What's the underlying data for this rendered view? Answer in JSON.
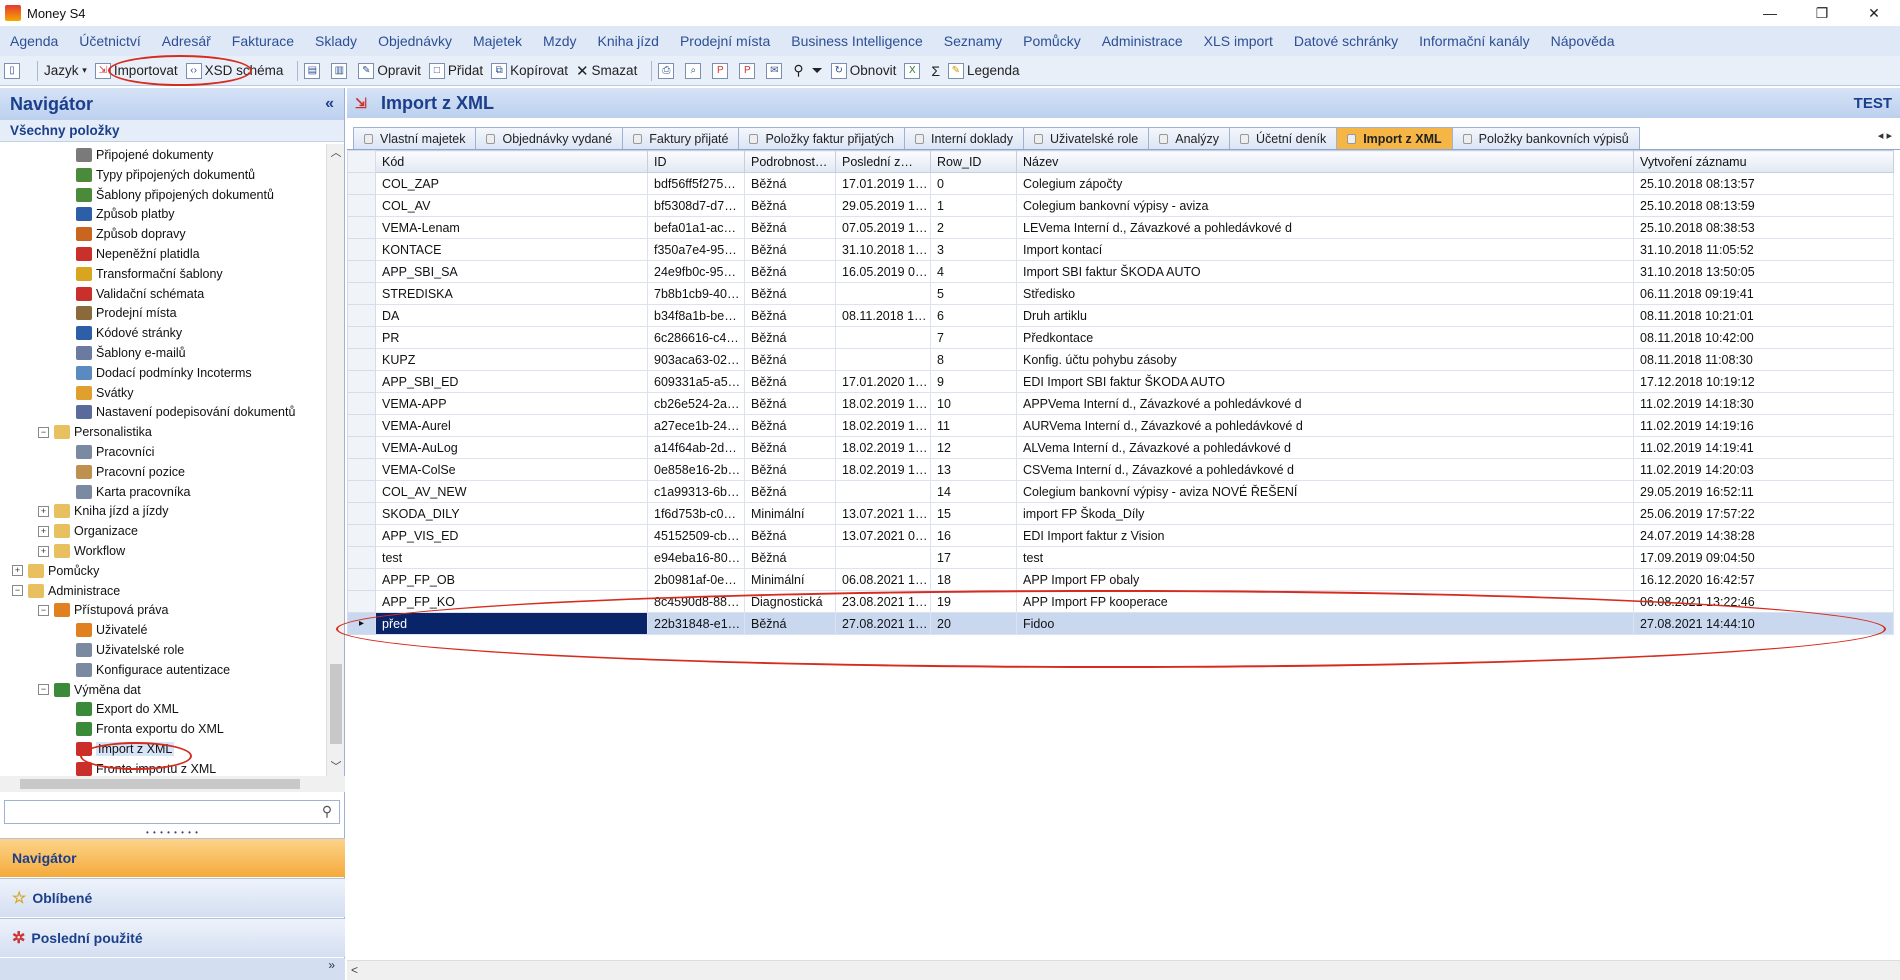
{
  "window": {
    "title": "Money S4",
    "controls": [
      "—",
      "❐",
      "✕"
    ]
  },
  "menu": [
    "Agenda",
    "Účetnictví",
    "Adresář",
    "Fakturace",
    "Sklady",
    "Objednávky",
    "Majetek",
    "Mzdy",
    "Kniha jízd",
    "Prodejní místa",
    "Business Intelligence",
    "Seznamy",
    "Pomůcky",
    "Administrace",
    "XLS import",
    "Datové schránky",
    "Informační kanály",
    "Nápověda"
  ],
  "toolbar": {
    "language": "Jazyk",
    "import": "Importovat",
    "xsd": "XSD schéma",
    "edit": "Opravit",
    "add": "Přidat",
    "copy": "Kopírovat",
    "delete": "Smazat",
    "refresh": "Obnovit",
    "legend": "Legenda"
  },
  "navigator": {
    "title": "Navigátor",
    "collapse": "«",
    "subtitle": "Všechny položky",
    "tree": [
      {
        "label": "Připojené dokumenty",
        "level": 3,
        "color": "#7a7a7a"
      },
      {
        "label": "Typy připojených dokumentů",
        "level": 3,
        "color": "#4a8a3a"
      },
      {
        "label": "Šablony připojených dokumentů",
        "level": 3,
        "color": "#4a8a3a"
      },
      {
        "label": "Způsob platby",
        "level": 3,
        "color": "#2d5fa8"
      },
      {
        "label": "Způsob dopravy",
        "level": 3,
        "color": "#c9651e"
      },
      {
        "label": "Nepeněžní platidla",
        "level": 3,
        "color": "#c9302c"
      },
      {
        "label": "Transformační šablony",
        "level": 3,
        "color": "#d9a521"
      },
      {
        "label": "Validační schémata",
        "level": 3,
        "color": "#c9302c"
      },
      {
        "label": "Prodejní místa",
        "level": 3,
        "color": "#8a6a3a"
      },
      {
        "label": "Kódové stránky",
        "level": 3,
        "color": "#2d5fa8"
      },
      {
        "label": "Šablony e-mailů",
        "level": 3,
        "color": "#6a7aa0"
      },
      {
        "label": "Dodací podmínky Incoterms",
        "level": 3,
        "color": "#5a8ac0"
      },
      {
        "label": "Svátky",
        "level": 3,
        "color": "#e0a030"
      },
      {
        "label": "Nastavení podepisování dokumentů",
        "level": 3,
        "color": "#5a6a9a"
      },
      {
        "label": "Personalistika",
        "level": 2,
        "exp": "−",
        "color": "#e8c060"
      },
      {
        "label": "Pracovníci",
        "level": 3,
        "color": "#7a8aa0"
      },
      {
        "label": "Pracovní pozice",
        "level": 3,
        "color": "#c09050"
      },
      {
        "label": "Karta pracovníka",
        "level": 3,
        "color": "#7a8aa0"
      },
      {
        "label": "Kniha jízd a jízdy",
        "level": 2,
        "exp": "+",
        "color": "#e8c060"
      },
      {
        "label": "Organizace",
        "level": 2,
        "exp": "+",
        "color": "#e8c060"
      },
      {
        "label": "Workflow",
        "level": 2,
        "exp": "+",
        "color": "#e8c060"
      },
      {
        "label": "Pomůcky",
        "level": 1,
        "exp": "+",
        "color": "#e8c060"
      },
      {
        "label": "Administrace",
        "level": 1,
        "exp": "−",
        "color": "#e8c060"
      },
      {
        "label": "Přístupová práva",
        "level": 2,
        "exp": "−",
        "color": "#e08020"
      },
      {
        "label": "Uživatelé",
        "level": 3,
        "color": "#e08020"
      },
      {
        "label": "Uživatelské role",
        "level": 3,
        "color": "#7a8aa0"
      },
      {
        "label": "Konfigurace autentizace",
        "level": 3,
        "color": "#7a8aa0"
      },
      {
        "label": "Výměna dat",
        "level": 2,
        "exp": "−",
        "color": "#3a8a3a"
      },
      {
        "label": "Export do XML",
        "level": 3,
        "color": "#3a8a3a"
      },
      {
        "label": "Fronta exportu do XML",
        "level": 3,
        "color": "#3a8a3a"
      },
      {
        "label": "Import z XML",
        "level": 3,
        "color": "#c9302c",
        "selected": true
      },
      {
        "label": "Fronta importu z XML",
        "level": 3,
        "color": "#c9302c"
      }
    ],
    "panels": [
      {
        "label": "Navigátor",
        "icon": "",
        "active": true
      },
      {
        "label": "Oblíbené",
        "icon": "☆"
      },
      {
        "label": "Poslední použité",
        "icon": "✲"
      }
    ],
    "footer": "»"
  },
  "main": {
    "title": "Import z XML",
    "badge": "TEST",
    "tabs": [
      "Vlastní majetek",
      "Objednávky vydané",
      "Faktury přijaté",
      "Položky faktur přijatých",
      "Interní doklady",
      "Uživatelské role",
      "Analýzy",
      "Účetní deník",
      "Import z XML",
      "Položky bankovních výpisů"
    ],
    "active_tab": "Import z XML",
    "tab_arrows": "◂ ▸",
    "columns": [
      "Kód",
      "ID",
      "Podrobnost…",
      "Poslední z…",
      "Row_ID",
      "Název",
      "Vytvoření záznamu"
    ],
    "rows": [
      [
        "COL_ZAP",
        "bdf56ff5f275…",
        "Běžná",
        "17.01.2019 1…",
        "0",
        "Colegium zápočty",
        "25.10.2018 08:13:57"
      ],
      [
        "COL_AV",
        "bf5308d7-d7…",
        "Běžná",
        "29.05.2019 1…",
        "1",
        "Colegium bankovní výpisy - aviza",
        "25.10.2018 08:13:59"
      ],
      [
        "VEMA-Lenam",
        "befa01a1-ac…",
        "Běžná",
        "07.05.2019 1…",
        "2",
        "LEVema Interní d., Závazkové a pohledávkové d",
        "25.10.2018 08:38:53"
      ],
      [
        "KONTACE",
        "f350a7e4-95…",
        "Běžná",
        "31.10.2018 1…",
        "3",
        "Import kontací",
        "31.10.2018 11:05:52"
      ],
      [
        "APP_SBI_SA",
        "24e9fb0c-95…",
        "Běžná",
        "16.05.2019 0…",
        "4",
        "Import SBI faktur ŠKODA AUTO",
        "31.10.2018 13:50:05"
      ],
      [
        "STREDISKA",
        "7b8b1cb9-40…",
        "Běžná",
        "",
        "5",
        "Středisko",
        "06.11.2018 09:19:41"
      ],
      [
        "DA",
        "b34f8a1b-be…",
        "Běžná",
        "08.11.2018 1…",
        "6",
        "Druh artiklu",
        "08.11.2018 10:21:01"
      ],
      [
        "PR",
        "6c286616-c4…",
        "Běžná",
        "",
        "7",
        "Předkontace",
        "08.11.2018 10:42:00"
      ],
      [
        "KUPZ",
        "903aca63-02…",
        "Běžná",
        "",
        "8",
        "Konfig. účtu pohybu zásoby",
        "08.11.2018 11:08:30"
      ],
      [
        "APP_SBI_ED",
        "609331a5-a5…",
        "Běžná",
        "17.01.2020 1…",
        "9",
        "EDI Import SBI faktur ŠKODA AUTO",
        "17.12.2018 10:19:12"
      ],
      [
        "VEMA-APP",
        "cb26e524-2a…",
        "Běžná",
        "18.02.2019 1…",
        "10",
        "APPVema Interní d., Závazkové a pohledávkové d",
        "11.02.2019 14:18:30"
      ],
      [
        "VEMA-Aurel",
        "a27ece1b-24…",
        "Běžná",
        "18.02.2019 1…",
        "11",
        "AURVema Interní d., Závazkové a pohledávkové d",
        "11.02.2019 14:19:16"
      ],
      [
        "VEMA-AuLog",
        "a14f64ab-2d…",
        "Běžná",
        "18.02.2019 1…",
        "12",
        "ALVema Interní d., Závazkové a pohledávkové d",
        "11.02.2019 14:19:41"
      ],
      [
        "VEMA-ColSe",
        "0e858e16-2b…",
        "Běžná",
        "18.02.2019 1…",
        "13",
        "CSVema Interní d., Závazkové a pohledávkové d",
        "11.02.2019 14:20:03"
      ],
      [
        "COL_AV_NEW",
        "c1a99313-6b…",
        "Běžná",
        "",
        "14",
        "Colegium bankovní výpisy - aviza NOVÉ ŘEŠENÍ",
        "29.05.2019 16:52:11"
      ],
      [
        "SKODA_DILY",
        "1f6d753b-c0…",
        "Minimální",
        "13.07.2021 1…",
        "15",
        "import FP Škoda_Díly",
        "25.06.2019 17:57:22"
      ],
      [
        "APP_VIS_ED",
        "45152509-cb…",
        "Běžná",
        "13.07.2021 0…",
        "16",
        "EDI Import faktur z Vision",
        "24.07.2019 14:38:28"
      ],
      [
        "test",
        "e94eba16-80…",
        "Běžná",
        "",
        "17",
        "test",
        "17.09.2019 09:04:50"
      ],
      [
        "APP_FP_OB",
        "2b0981af-0e…",
        "Minimální",
        "06.08.2021 1…",
        "18",
        "APP Import FP obaly",
        "16.12.2020 16:42:57"
      ],
      [
        "APP_FP_KO",
        "8c4590d8-88…",
        "Diagnostická",
        "23.08.2021 1…",
        "19",
        "APP Import FP kooperace",
        "06.08.2021 13:22:46"
      ],
      [
        "před",
        "22b31848-e1…",
        "Běžná",
        "27.08.2021 1…",
        "20",
        "Fidoo",
        "27.08.2021 14:44:10"
      ]
    ],
    "selected_row": 20,
    "scroll_left": "<"
  },
  "annotation_color": "#d62b1e"
}
